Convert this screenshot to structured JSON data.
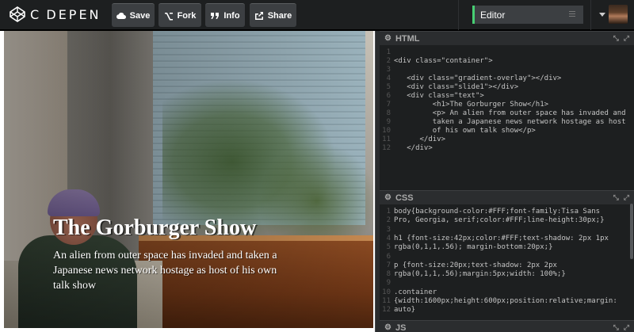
{
  "app": {
    "logo_text": "C DEPEN",
    "buttons": [
      {
        "name": "save",
        "label": "Save",
        "icon": "cloud-icon"
      },
      {
        "name": "fork",
        "label": "Fork",
        "icon": "fork-icon"
      },
      {
        "name": "info",
        "label": "Info",
        "icon": "quote-icon"
      },
      {
        "name": "share",
        "label": "Share",
        "icon": "share-icon"
      }
    ],
    "view_select": "Editor",
    "accent": "#47cf73"
  },
  "preview": {
    "title": "The Gorburger Show",
    "description": "An alien from outer space has invaded and taken a Japanese news network hostage as host of his own talk show"
  },
  "panes": {
    "html": {
      "label": "HTML",
      "line_numbers": [
        "1",
        "2",
        "3",
        "4",
        "5",
        "6",
        "7",
        "8",
        "9",
        "10",
        "11",
        "12"
      ],
      "lines": [
        "",
        "<div class=\"container\">",
        "",
        "   <div class=\"gradient-overlay\"></div>",
        "   <div class=\"slide1\"></div>",
        "   <div class=\"text\">",
        "         <h1>The Gorburger Show</h1>",
        "         <p> An alien from outer space has invaded and",
        "         taken a Japanese news network hostage as host",
        "         of his own talk show</p>",
        "      </div>",
        "   </div>"
      ]
    },
    "css": {
      "label": "CSS",
      "line_numbers": [
        "1",
        "2",
        "3",
        "4",
        "5",
        "6",
        "7",
        "8",
        "9",
        "10",
        "11",
        "12"
      ],
      "lines": [
        "body{background-color:#FFF;font-family:Tisa Sans",
        "Pro, Georgia, serif;color:#FFF;line-height:30px;}",
        "",
        "h1 {font-size:42px;color:#FFF;text-shadow: 2px 1px",
        "rgba(0,1,1,.56); margin-bottom:20px;}",
        "",
        "p {font-size:20px;text-shadow: 2px 2px",
        "rgba(0,1,1,.56);margin:5px;width: 100%;}",
        "",
        ".container",
        "{width:1600px;height:600px;position:relative;margin:",
        "auto}"
      ]
    },
    "js": {
      "label": "JS"
    }
  }
}
